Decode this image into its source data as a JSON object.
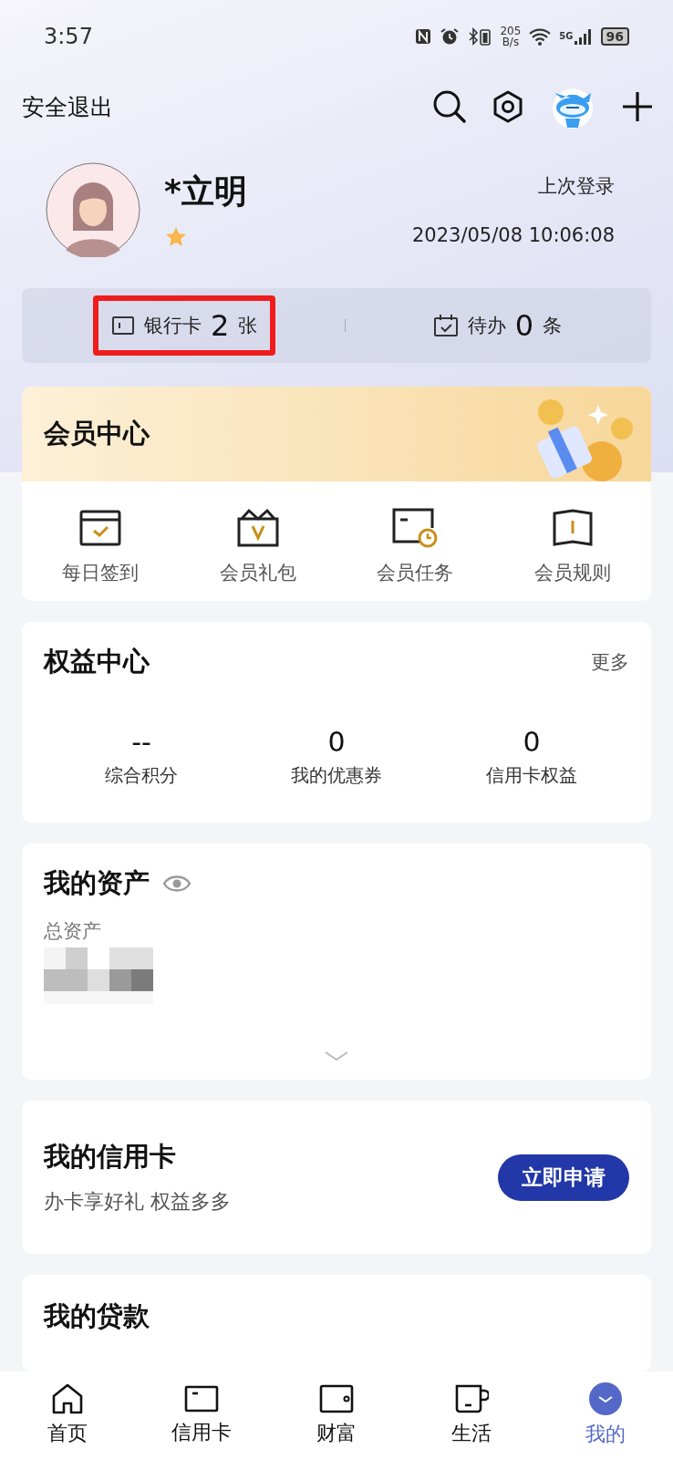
{
  "status_bar": {
    "time": "3:57",
    "speed": "205",
    "speed_unit": "B/s",
    "network": "5G",
    "battery": "96"
  },
  "header": {
    "logout": "安全退出"
  },
  "profile": {
    "name": "*立明",
    "last_login_label": "上次登录",
    "last_login_time": "2023/05/08 10:06:08"
  },
  "stats": [
    {
      "kind": "card",
      "label": "银行卡",
      "count": "2",
      "unit": "张",
      "highlighted": true
    },
    {
      "kind": "todo",
      "label": "待办",
      "count": "0",
      "unit": "条",
      "highlighted": false
    }
  ],
  "member_center": {
    "title": "会员中心",
    "items": [
      {
        "kind": "checkin",
        "label": "每日签到"
      },
      {
        "kind": "gift",
        "label": "会员礼包"
      },
      {
        "kind": "task",
        "label": "会员任务"
      },
      {
        "kind": "rules",
        "label": "会员规则"
      }
    ]
  },
  "rights_center": {
    "title": "权益中心",
    "more": "更多",
    "metrics": [
      {
        "value": "--",
        "label": "综合积分"
      },
      {
        "value": "0",
        "label": "我的优惠券"
      },
      {
        "value": "0",
        "label": "信用卡权益"
      }
    ]
  },
  "assets": {
    "title": "我的资产",
    "total_label": "总资产"
  },
  "credit_card": {
    "title": "我的信用卡",
    "subtitle": "办卡享好礼 权益多多",
    "button": "立即申请"
  },
  "loans": {
    "title": "我的贷款"
  },
  "tab_bar": [
    {
      "kind": "home",
      "label": "首页",
      "selected": false
    },
    {
      "kind": "card",
      "label": "信用卡",
      "selected": false
    },
    {
      "kind": "wallet",
      "label": "财富",
      "selected": false
    },
    {
      "kind": "cup",
      "label": "生活",
      "selected": false
    },
    {
      "kind": "me",
      "label": "我的",
      "selected": true
    }
  ]
}
